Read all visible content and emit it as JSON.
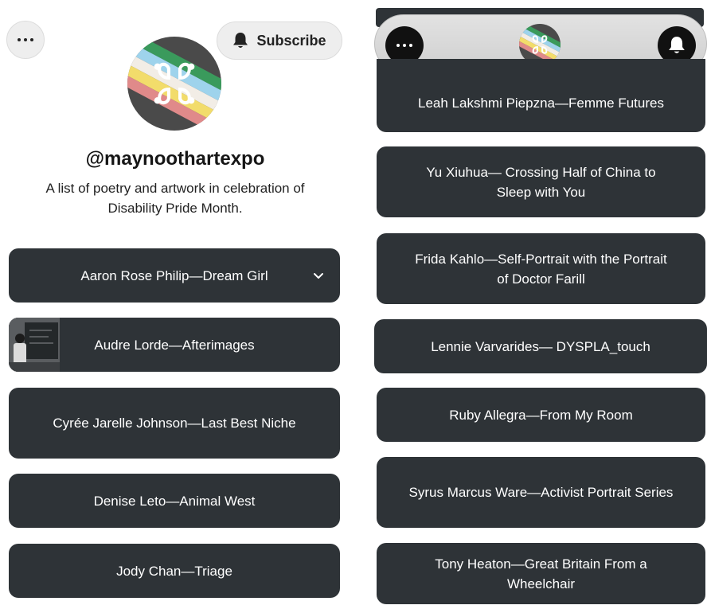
{
  "profile": {
    "more_icon": "more-horizontal-icon",
    "subscribe_label": "Subscribe",
    "subscribe_icon": "bell-icon",
    "handle": "@maynoothartexpo",
    "bio": "A list of poetry and artwork in celebration of Disability Pride Month.",
    "avatar_icon": "disability-pride-flag-logo"
  },
  "left_links": [
    {
      "label": "Aaron Rose Philip—Dream Girl",
      "expanded_icon": "chevron-down-icon"
    },
    {
      "label": "Audre Lorde—Afterimages",
      "has_thumbnail": true
    },
    {
      "label": "Cyrée Jarelle Johnson—Last Best Niche"
    },
    {
      "label": "Denise Leto—Animal West"
    },
    {
      "label": "Jody Chan—Triage"
    }
  ],
  "right_links": [
    {
      "label": "Leah Lakshmi Piepzna—Femme Futures"
    },
    {
      "label": "Yu Xiuhua— Crossing Half of China to Sleep with You"
    },
    {
      "label": "Frida Kahlo—Self-Portrait with the Portrait of Doctor Farill"
    },
    {
      "label": "Lennie Varvarides— DYSPLA_touch"
    },
    {
      "label": "Ruby Allegra—From My Room"
    },
    {
      "label": "Syrus Marcus Ware—Activist Portrait Series"
    },
    {
      "label": "Tony Heaton—Great Britain From a Wheelchair"
    }
  ],
  "colors": {
    "card_bg": "#2e3337",
    "card_text": "#ffffff",
    "button_bg": "#eeeeee",
    "flag_stripes": [
      "#3a9a5c",
      "#9ed3ec",
      "#f2ede6",
      "#f2dc6b",
      "#e08a8a"
    ],
    "flag_bg": "#4a4a4a"
  }
}
